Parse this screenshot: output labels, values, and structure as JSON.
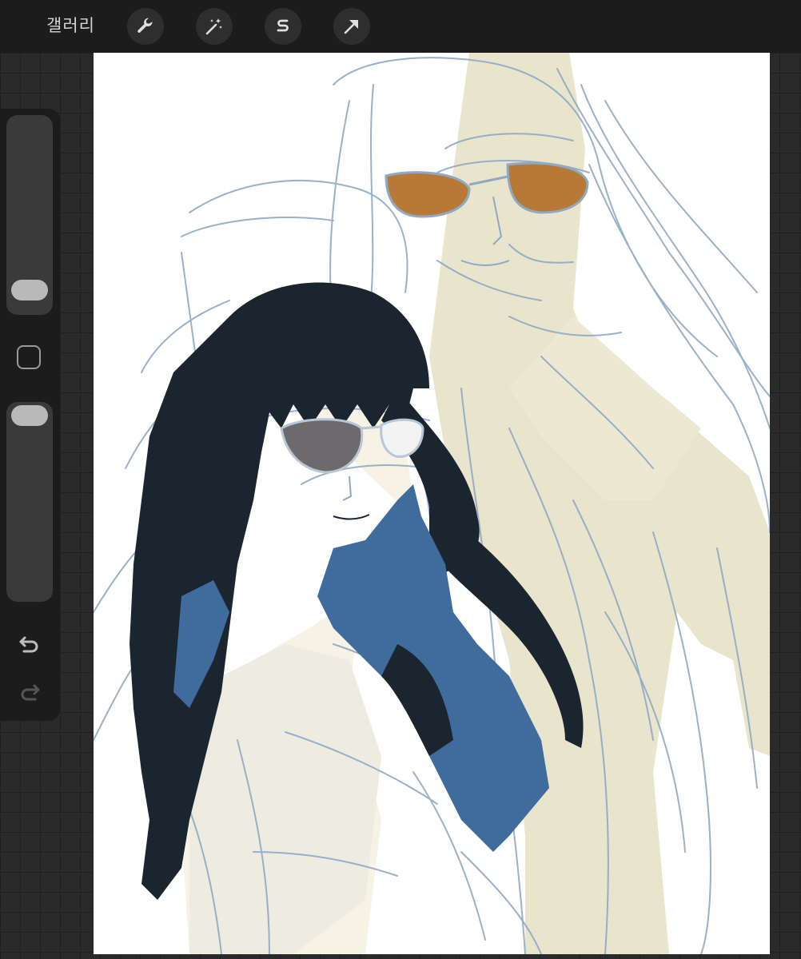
{
  "app": {
    "gallery_label": "갤러리"
  },
  "toolbar": {
    "tools": [
      "wrench-icon",
      "magic-wand-icon",
      "selection-s-icon",
      "transform-arrow-icon"
    ]
  },
  "sidebar": {
    "brush_size_level": 0.12,
    "opacity_level": 0.9,
    "controls": [
      "brush-size-slider",
      "modify-square-button",
      "opacity-slider",
      "undo-icon",
      "redo-icon"
    ]
  },
  "colors": {
    "toolbar_bg": "#1c1c1c",
    "canvas_bg": "#ffffff",
    "hair_black": "#1b2530",
    "scarf_blue": "#3f6c9d",
    "sketch_line": "#8fa9c4",
    "skin_beige": "#e8e3c9",
    "lens_orange": "#b87836",
    "lens_gray": "#6d6a6e"
  }
}
